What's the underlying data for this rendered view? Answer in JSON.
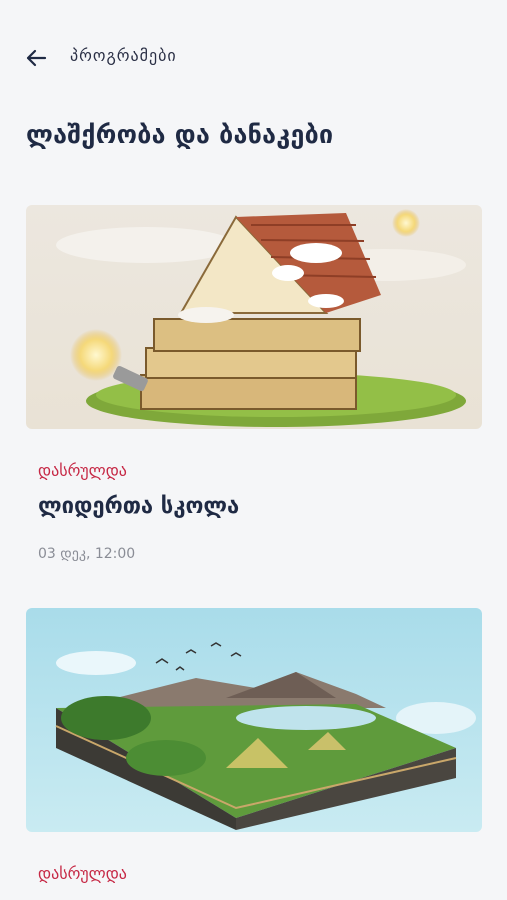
{
  "header": {
    "back_icon": "arrow-left-icon",
    "title": "პროგრამები"
  },
  "page": {
    "title": "ლაშქრობა და ბანაკები"
  },
  "events": [
    {
      "image": "book-house-with-lightbulb",
      "status": "დასრულდა",
      "title": "ლიდერთა სკოლა",
      "date": "03 დეკ, 12:00"
    },
    {
      "image": "3d-landscape-with-tents",
      "status": "დასრულდა"
    }
  ],
  "colors": {
    "status": "#c62845",
    "title": "#1f2a44",
    "background": "#f5f6f8"
  }
}
